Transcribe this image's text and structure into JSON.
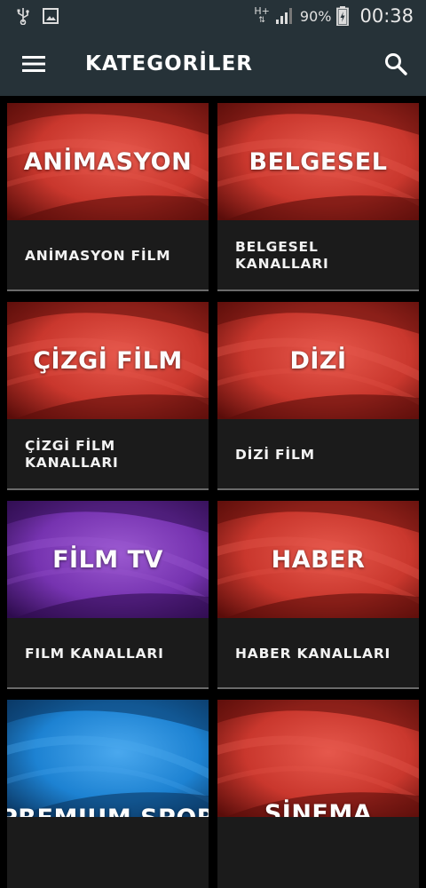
{
  "status_bar": {
    "network": "H+",
    "battery": "90%",
    "time": "00:38",
    "icons": [
      "usb-icon",
      "image-icon",
      "signal-icon",
      "battery-charging-icon"
    ]
  },
  "app_bar": {
    "title": "KATEGORİLER",
    "menu_icon": "hamburger-menu-icon",
    "search_icon": "search-icon"
  },
  "colors": {
    "app_bar": "#263238",
    "card_background": "#1b1b1b",
    "red_banner": "#c0392b",
    "purple_banner": "#6a2a9c",
    "blue_banner": "#1f78c8"
  },
  "categories": [
    {
      "banner": "ANİMASYON",
      "caption": "ANİMASYON FİLM",
      "theme": "red"
    },
    {
      "banner": "BELGESEL",
      "caption": "BELGESEL KANALLARI",
      "theme": "red"
    },
    {
      "banner": "ÇİZGİ FİLM",
      "caption": "ÇİZGİ FİLM KANALLARI",
      "theme": "red"
    },
    {
      "banner": "DİZİ",
      "caption": "DİZİ FİLM",
      "theme": "red"
    },
    {
      "banner": "FİLM TV",
      "caption": "FILM KANALLARI",
      "theme": "purple"
    },
    {
      "banner": "HABER",
      "caption": "HABER KANALLARI",
      "theme": "red"
    },
    {
      "banner": "PREMIUM SPOR",
      "caption": "",
      "theme": "blue"
    },
    {
      "banner": "SİNEMA",
      "caption": "",
      "theme": "red"
    }
  ]
}
